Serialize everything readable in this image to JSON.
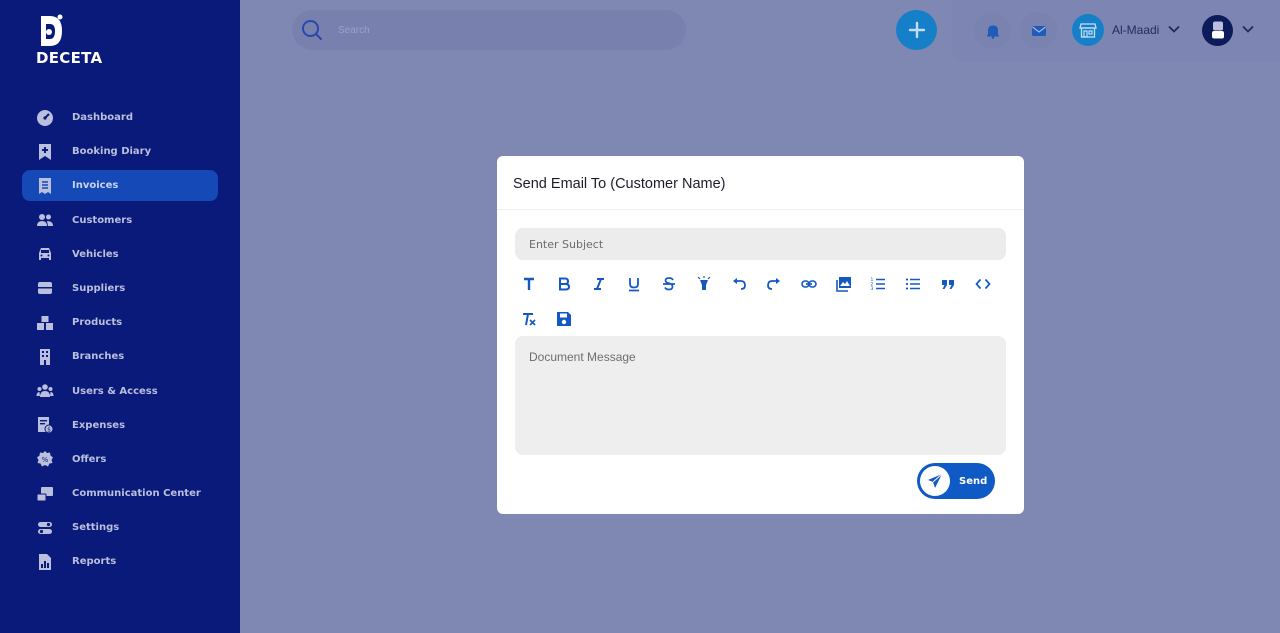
{
  "brand": {
    "name": "DECETA"
  },
  "sidebar": {
    "items": [
      {
        "label": "Dashboard",
        "icon": "dashboard-icon"
      },
      {
        "label": "Booking Diary",
        "icon": "booking-diary-icon"
      },
      {
        "label": "Invoices",
        "icon": "invoice-icon",
        "active": true
      },
      {
        "label": "Customers",
        "icon": "customers-icon"
      },
      {
        "label": "Vehicles",
        "icon": "car-icon"
      },
      {
        "label": "Suppliers",
        "icon": "suppliers-icon"
      },
      {
        "label": "Products",
        "icon": "products-icon"
      },
      {
        "label": "Branches",
        "icon": "building-icon"
      },
      {
        "label": "Users & Access",
        "icon": "users-icon"
      },
      {
        "label": "Expenses",
        "icon": "expenses-icon"
      },
      {
        "label": "Offers",
        "icon": "offers-icon"
      },
      {
        "label": "Communication Center",
        "icon": "communication-icon"
      },
      {
        "label": "Settings",
        "icon": "settings-icon"
      },
      {
        "label": "Reports",
        "icon": "reports-icon"
      }
    ]
  },
  "header": {
    "search_placeholder": "Search",
    "branch_name": "Al-Maadi"
  },
  "modal": {
    "title": "Send Email To (Customer Name)",
    "subject_placeholder": "Enter Subject",
    "message_placeholder": "Document Message",
    "send_label": "Send",
    "toolbar": [
      "heading",
      "bold",
      "italic",
      "underline",
      "strikethrough",
      "highlight",
      "undo",
      "redo",
      "link",
      "image",
      "ordered-list",
      "bullet-list",
      "quote",
      "code",
      "clear-format",
      "save"
    ]
  },
  "colors": {
    "sidebar_bg": "#0a1a7a",
    "active_item": "#1549b8",
    "accent": "#157fc8",
    "send_button": "#0f5ac5",
    "overlay": "#7f87b3"
  }
}
